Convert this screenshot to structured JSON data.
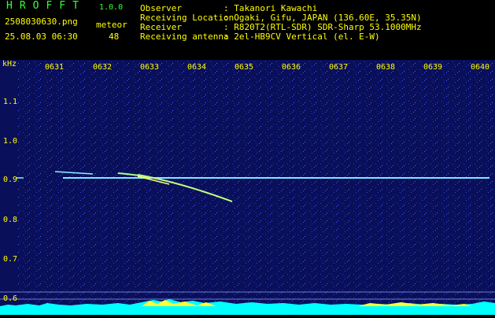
{
  "header": {
    "app_title": "HROFFT",
    "app_version": "1.0.0",
    "file_name": "2508030630.png",
    "timestamp": "25.08.03 06:30",
    "meteor_label": "meteor",
    "meteor_count": "48",
    "info": [
      {
        "label": "Observer",
        "value": ": Takanori Kawachi"
      },
      {
        "label": "Receiving Location",
        "value": ": Ogaki, Gifu, JAPAN (136.60E, 35.35N)"
      },
      {
        "label": "Receiver",
        "value": ": R820T2(RTL-SDR) SDR-Sharp 53.1000MHz"
      },
      {
        "label": "Receiving antenna",
        "value": ": 2el-HB9CV Vertical (el. E-W)"
      }
    ]
  },
  "spectrogram": {
    "y_unit": "kHz",
    "y_ticks": [
      "1.1",
      "1.0",
      "0.9",
      "0.8",
      "0.7",
      "0.6"
    ],
    "x_ticks": [
      "0631",
      "0632",
      "0633",
      "0634",
      "0635",
      "0636",
      "0637",
      "0638",
      "0639",
      "0640"
    ],
    "colors": {
      "background": "#0a0f5a",
      "carrier": "#7fe8ff",
      "meteor": "#bfff7f",
      "activity": "#ffff33",
      "power": "#00ffff",
      "labels": "#ffff00"
    }
  }
}
